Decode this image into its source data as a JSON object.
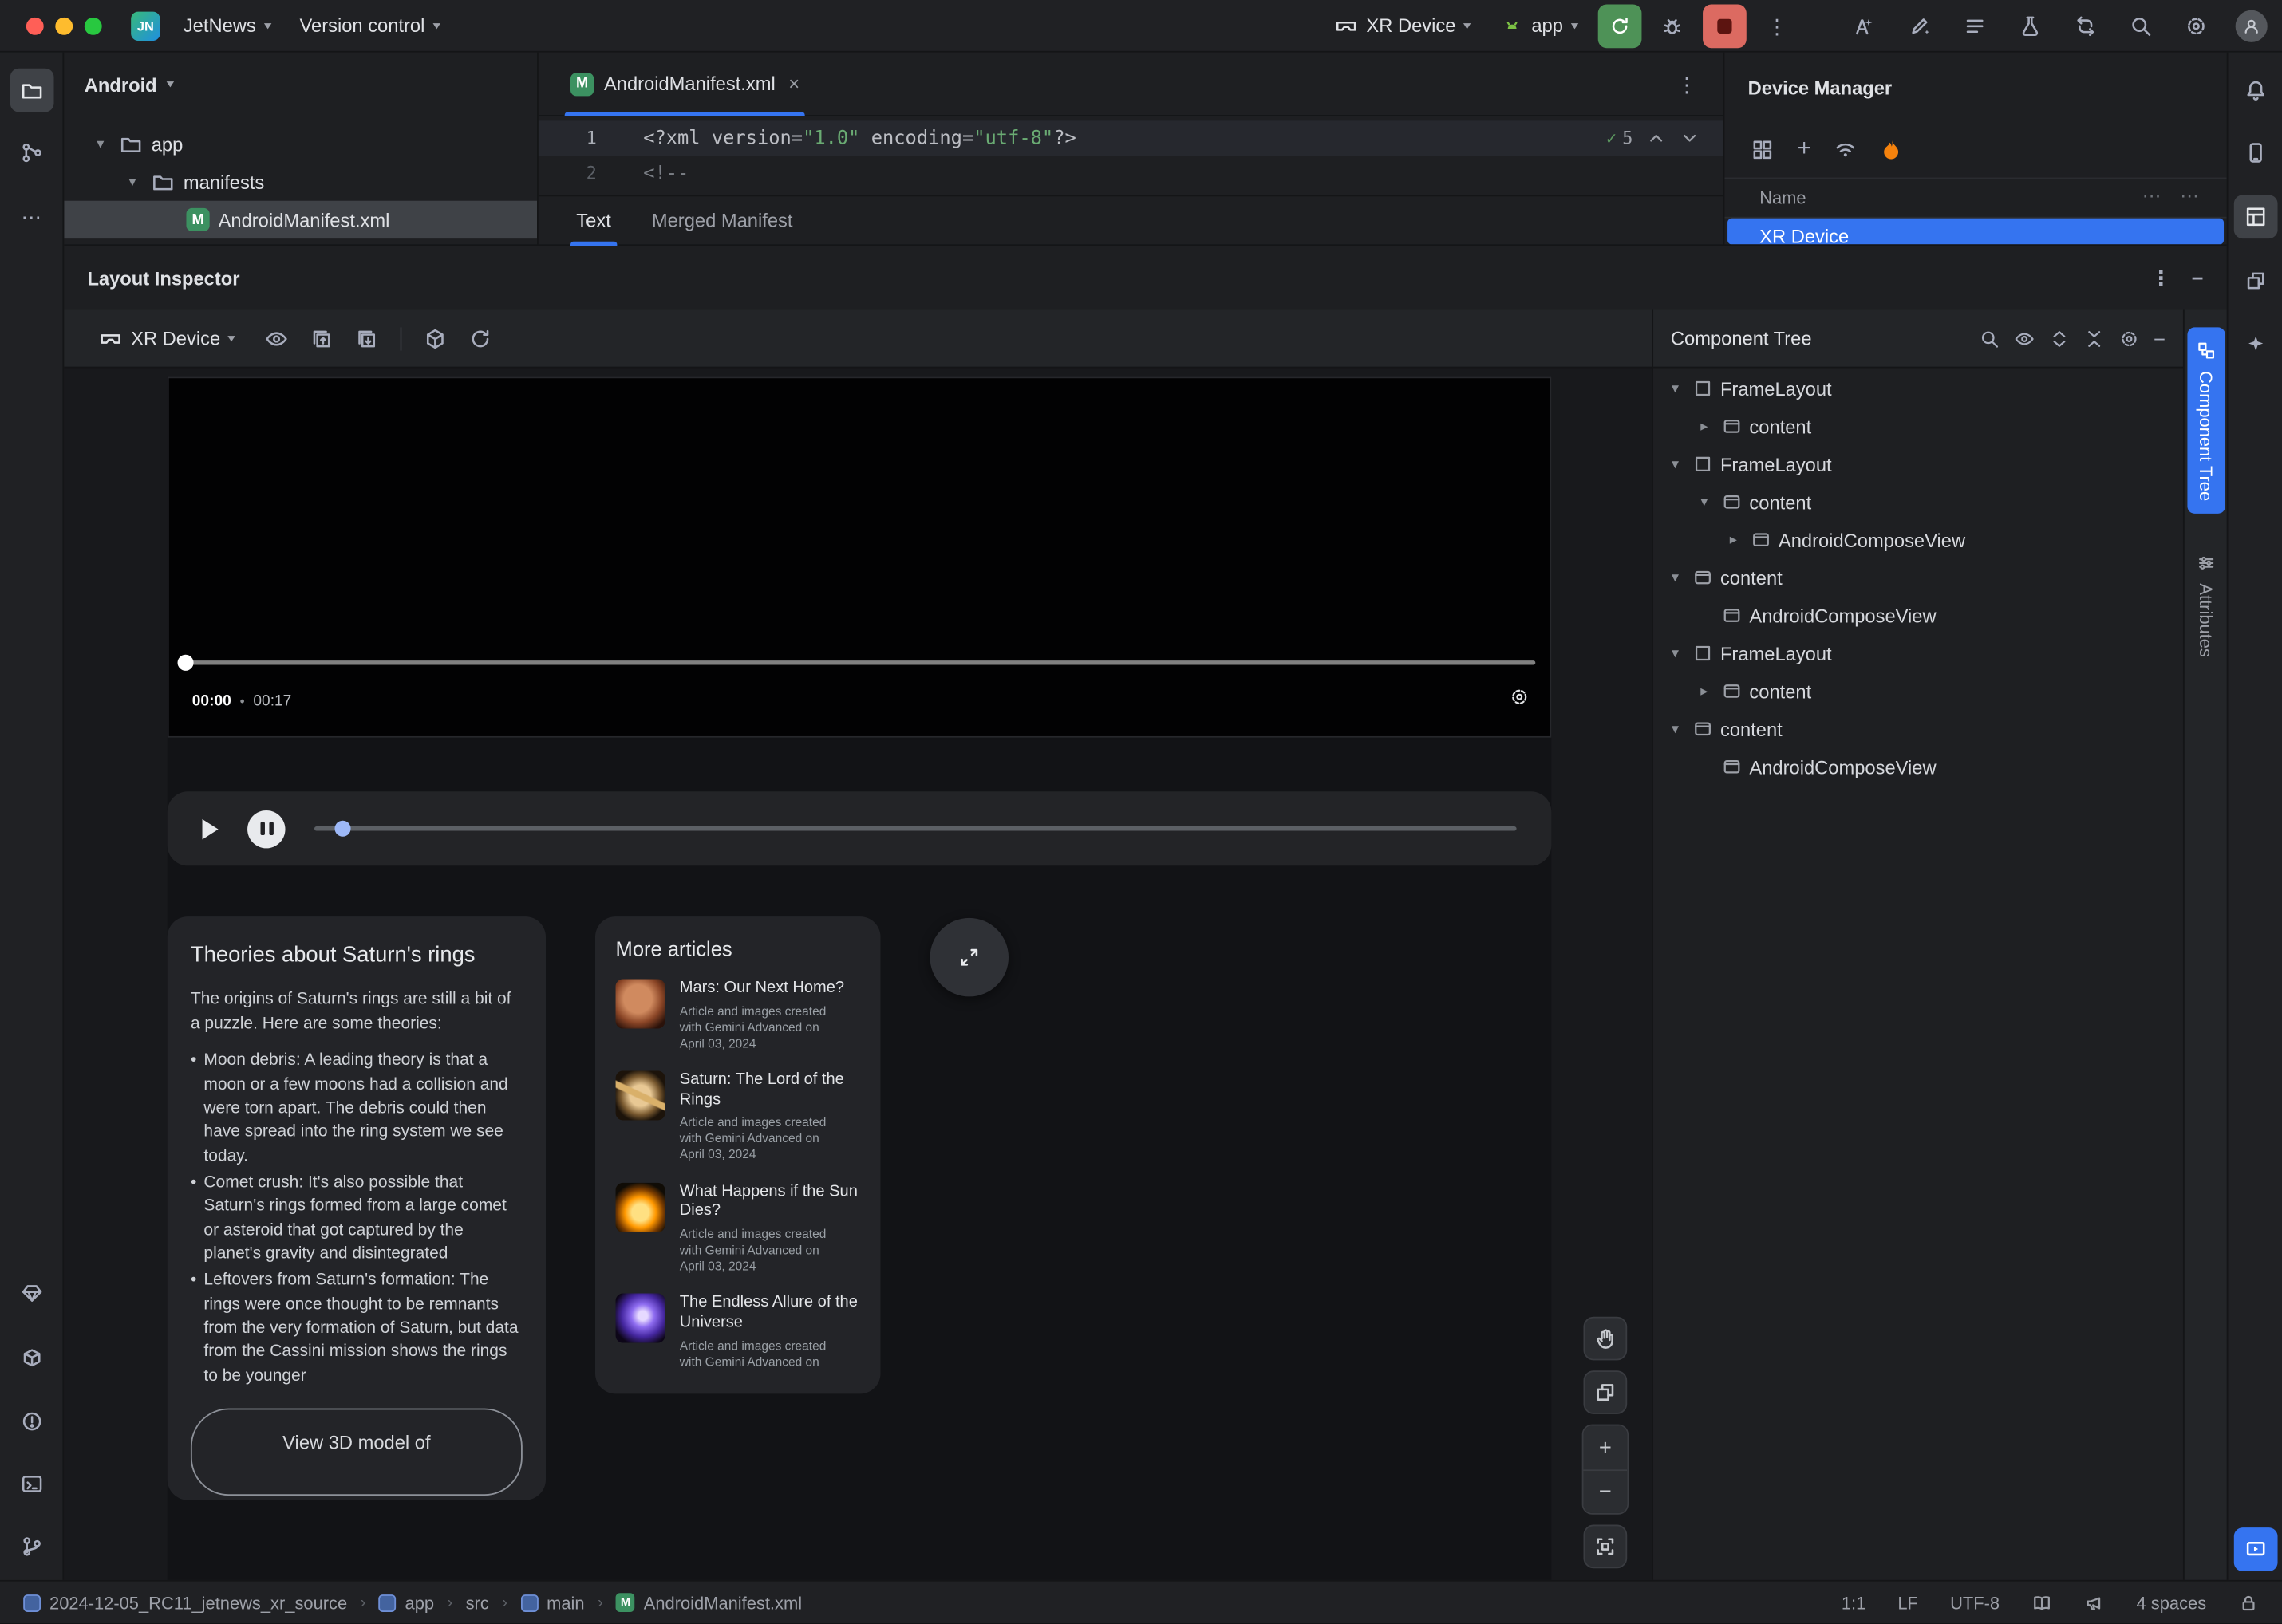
{
  "icons": {
    "close": "×",
    "more_v": "⋮",
    "more_h": "⋯",
    "chev_down": "▾",
    "chev_right": "▸",
    "plus": "+",
    "minus": "−",
    "check": "✓",
    "dot": "•",
    "crumb_sep": "›",
    "m": "M",
    "jn": "JN"
  },
  "titlebar": {
    "project": "JetNews",
    "vcs": "Version control",
    "device": "XR Device",
    "run_config": "app"
  },
  "project_panel": {
    "title": "Android",
    "nodes": [
      {
        "label": "app"
      },
      {
        "label": "manifests"
      },
      {
        "label": "AndroidManifest.xml"
      }
    ]
  },
  "editor": {
    "tab": "AndroidManifest.xml",
    "inspections": "5",
    "gutter": [
      "1",
      "2"
    ],
    "code": {
      "xml_open": "<?xml version=",
      "version_value": "\"1.0\"",
      "encoding_attr": " encoding=",
      "encoding_value": "\"utf-8\"",
      "xml_close": "?>",
      "comment_open": "<!--"
    },
    "subtabs": {
      "text": "Text",
      "merged": "Merged Manifest"
    }
  },
  "device_manager": {
    "title": "Device Manager",
    "name_column": "Name",
    "device": "XR Device"
  },
  "layout_inspector": {
    "title": "Layout Inspector",
    "process": "XR Device",
    "tree_panel_title": "Component Tree",
    "side_tabs": {
      "component_tree": "Component Tree",
      "attributes": "Attributes"
    },
    "tree": [
      {
        "label": "FrameLayout"
      },
      {
        "label": "content"
      },
      {
        "label": "FrameLayout"
      },
      {
        "label": "content"
      },
      {
        "label": "AndroidComposeView"
      },
      {
        "label": "content"
      },
      {
        "label": "AndroidComposeView"
      },
      {
        "label": "FrameLayout"
      },
      {
        "label": "content"
      },
      {
        "label": "content"
      },
      {
        "label": "AndroidComposeView"
      }
    ]
  },
  "preview": {
    "video": {
      "elapsed": "00:00",
      "duration": "00:17"
    },
    "theories_card": {
      "title": "Theories about Saturn's rings",
      "intro": "The origins of Saturn's rings are still a bit of a puzzle. Here are some theories:",
      "bullets": [
        "Moon debris: A leading theory is that a moon or a few moons had a collision and were torn apart. The debris could then have spread into the ring system we see today.",
        "Comet crush: It's also possible that Saturn's rings formed from a large comet or asteroid that got captured by the planet's gravity and disintegrated",
        "Leftovers from Saturn's formation: The rings were once thought to be remnants from the very formation of Saturn, but data from the Cassini mission shows the rings to be younger"
      ],
      "button": "View 3D model of"
    },
    "articles_card": {
      "title": "More articles",
      "items": [
        {
          "title": "Mars: Our Next Home?",
          "caption": "Article and images created with Gemini Advanced on April 03, 2024"
        },
        {
          "title": "Saturn: The Lord of the Rings",
          "caption": "Article and images created with Gemini Advanced on April 03, 2024"
        },
        {
          "title": "What Happens if the Sun Dies?",
          "caption": "Article and images created with Gemini Advanced on April 03, 2024"
        },
        {
          "title": "The Endless Allure of the Universe",
          "caption": "Article and images created with Gemini Advanced on"
        }
      ]
    }
  },
  "status_bar": {
    "breadcrumbs": [
      "2024-12-05_RC11_jetnews_xr_source",
      "app",
      "src",
      "main",
      "AndroidManifest.xml"
    ],
    "caret_position": "1:1",
    "line_separator": "LF",
    "encoding": "UTF-8",
    "indent": "4 spaces"
  },
  "colors": {
    "accent": "#3574f0",
    "string_green": "#6aab73",
    "firebase_orange": "#f5820d"
  }
}
